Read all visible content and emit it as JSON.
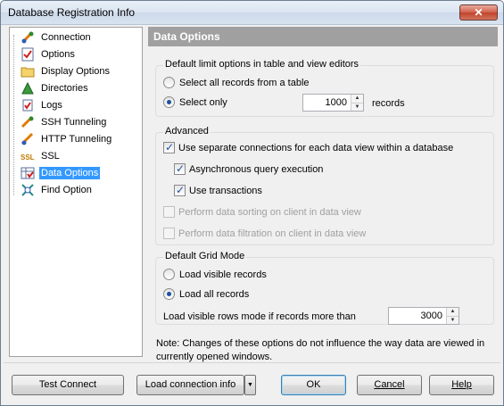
{
  "window": {
    "title": "Database Registration Info",
    "close_label": "✕"
  },
  "nav": {
    "items": [
      {
        "label": "Connection",
        "icon": "connection-icon"
      },
      {
        "label": "Options",
        "icon": "options-icon"
      },
      {
        "label": "Display Options",
        "icon": "folder-icon"
      },
      {
        "label": "Directories",
        "icon": "directories-icon"
      },
      {
        "label": "Logs",
        "icon": "logs-icon"
      },
      {
        "label": "SSH Tunneling",
        "icon": "ssh-icon"
      },
      {
        "label": "HTTP Tunneling",
        "icon": "http-icon"
      },
      {
        "label": "SSL",
        "icon": "ssl-icon"
      },
      {
        "label": "Data Options",
        "icon": "data-options-icon",
        "selected": true
      },
      {
        "label": "Find Option",
        "icon": "find-icon"
      }
    ]
  },
  "section": {
    "title": "Data Options"
  },
  "limit_group": {
    "title": "Default limit options in table and view editors",
    "select_all_label": "Select all records from a table",
    "select_only_label": "Select only",
    "select_only_value": "1000",
    "records_label": "records"
  },
  "advanced_group": {
    "title": "Advanced",
    "separate_connections_label": "Use separate connections for each data view within a database",
    "async_label": "Asynchronous query execution",
    "transactions_label": "Use transactions",
    "sorting_label": "Perform data sorting on client in data view",
    "filtration_label": "Perform data filtration on client in data view"
  },
  "grid_group": {
    "title": "Default Grid Mode",
    "load_visible_label": "Load visible records",
    "load_all_label": "Load all records",
    "threshold_label": "Load visible rows mode if records more than",
    "threshold_value": "3000"
  },
  "note": "Note: Changes of these options do not influence the way data are viewed in currently opened windows.",
  "footer": {
    "test_connect": "Test Connect",
    "load_connection_info": "Load connection info",
    "ok": "OK",
    "cancel": "Cancel",
    "help": "Help"
  }
}
